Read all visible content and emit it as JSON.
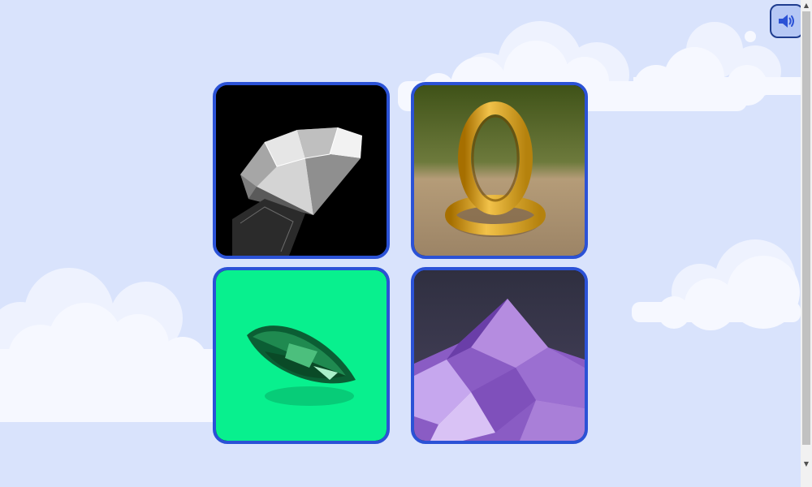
{
  "colors": {
    "background": "#d9e3fc",
    "card_border": "#2b52d6",
    "sound_button_fill": "#b6c8f5",
    "sound_button_border": "#1f3d8f",
    "sound_icon": "#2b52d6",
    "cloud": "#f4f7ff"
  },
  "sound_button": {
    "icon": "speaker-volume-icon"
  },
  "cards": [
    {
      "subject": "diamond-image"
    },
    {
      "subject": "gold-rings-image"
    },
    {
      "subject": "emerald-image"
    },
    {
      "subject": "amethyst-image"
    }
  ],
  "scrollbar": {
    "up_arrow": "▲",
    "down_arrow": "▼"
  }
}
